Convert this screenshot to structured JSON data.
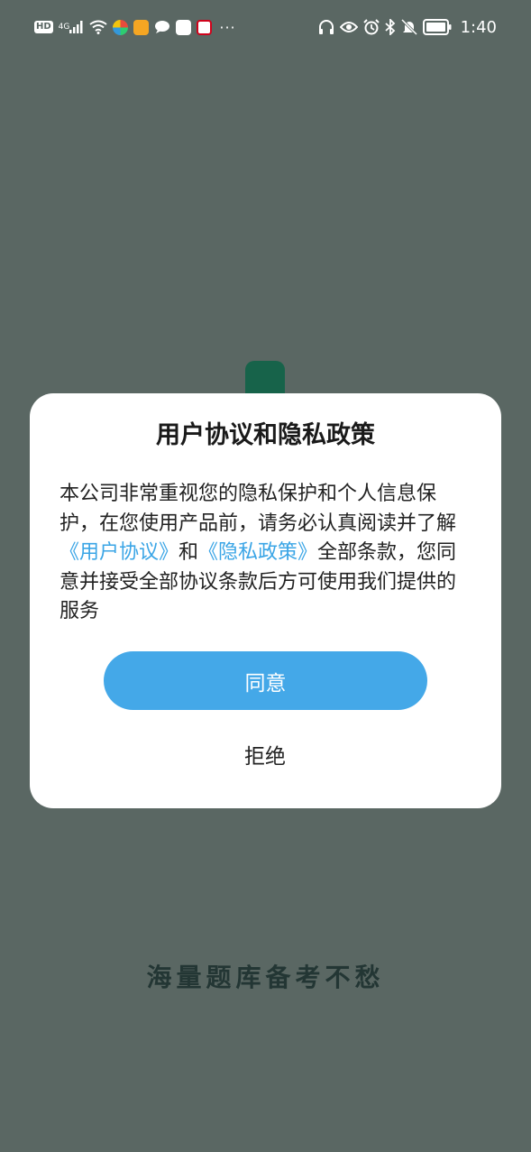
{
  "status_bar": {
    "hd_label": "HD",
    "network_label": "4G",
    "more_label": "···",
    "time": "1:40",
    "left_icons": [
      "hd-icon",
      "cellular-signal-icon",
      "wifi-icon",
      "colorful-app-icon",
      "weibo-icon",
      "chat-bubble-icon",
      "tiktok-icon",
      "news-app-icon",
      "more-icon"
    ],
    "right_icons": [
      "headphones-icon",
      "eye-icon",
      "alarm-icon",
      "bluetooth-icon",
      "mute-icon",
      "battery-icon"
    ]
  },
  "splash": {
    "slogan": "海量题库备考不愁",
    "logo_color": "#17634a"
  },
  "dialog": {
    "title": "用户协议和隐私政策",
    "body_part1": "本公司非常重视您的隐私保护和个人信息保护，在您使用产品前，请务必认真阅读并了解",
    "link_user_agreement": "《用户协议》",
    "body_and": "和",
    "link_privacy_policy": "《隐私政策》",
    "body_part2": "全部条款，您同意并接受全部协议条款后方可使用我们提供的服务",
    "agree_label": "同意",
    "reject_label": "拒绝"
  },
  "colors": {
    "overlay_background": "#5a6763",
    "accent": "#44a8e8",
    "link": "#3aa5e6",
    "dialog_background": "#ffffff"
  }
}
